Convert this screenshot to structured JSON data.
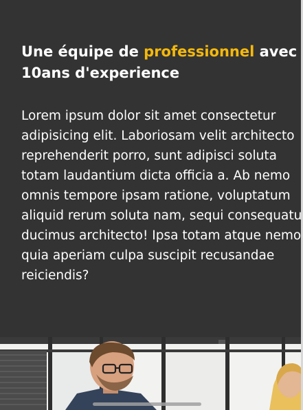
{
  "about": {
    "headline_part1": "Une équipe de ",
    "headline_accent": "professionnel",
    "headline_part2": " avec",
    "headline_line2": "10ans d'experience",
    "accent_color": "#f5b90c",
    "background_color": "#333333",
    "paragraph_lines": [
      "Lorem ipsum dolor sit amet consectetur",
      "adipisicing elit. Laboriosam velit architecto",
      "reprehenderit porro, sunt adipisci soluta",
      "totam laudantium dicta officia a. Ab nemo",
      "omnis tempore ipsam ratione, voluptatum",
      "aliquid rerum soluta nam, sequi consequatur",
      "ducimus architecto! Ipsa totam atque nemo",
      "quia aperiam culpa suscipit recusandae",
      "reiciendis?"
    ]
  },
  "photo": {
    "subject": "team-meeting-photo"
  }
}
